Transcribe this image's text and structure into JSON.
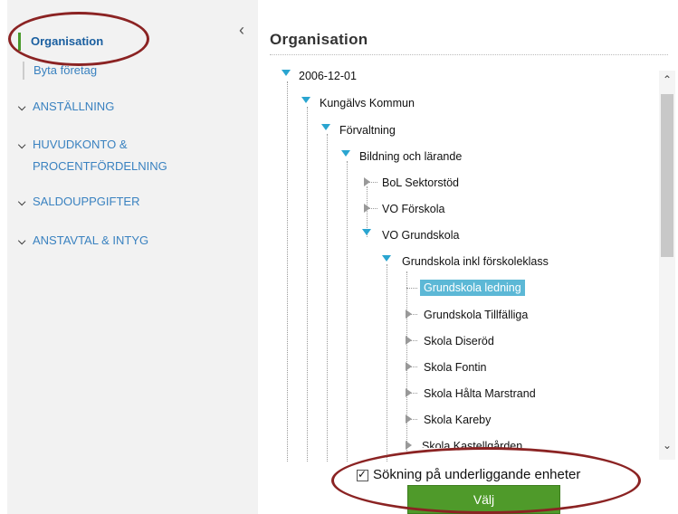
{
  "sidebar": {
    "active_item": "Organisation",
    "sub_item": "Byta företag",
    "collapse_icon": "chevron-left-icon",
    "sections": [
      {
        "label": "ANSTÄLLNING"
      },
      {
        "label_line1": "HUVUDKONTO &",
        "label_line2": "PROCENTFÖRDELNING"
      },
      {
        "label": "SALDOUPPGIFTER"
      },
      {
        "label": "ANSTAVTAL & INTYG"
      }
    ]
  },
  "main": {
    "title": "Organisation"
  },
  "tree": {
    "nodes": [
      {
        "label": "2006-12-01",
        "state": "expanded"
      },
      {
        "label": "Kungälvs Kommun",
        "state": "expanded"
      },
      {
        "label": "Förvaltning",
        "state": "expanded"
      },
      {
        "label": "Bildning och lärande",
        "state": "expanded"
      },
      {
        "label": "BoL Sektorstöd",
        "state": "collapsed"
      },
      {
        "label": "VO Förskola",
        "state": "collapsed"
      },
      {
        "label": "VO Grundskola",
        "state": "expanded"
      },
      {
        "label": "Grundskola inkl förskoleklass",
        "state": "expanded"
      },
      {
        "label": "Grundskola ledning",
        "state": "selected"
      },
      {
        "label": "Grundskola Tillfälliga",
        "state": "collapsed"
      },
      {
        "label": "Skola Diseröd",
        "state": "collapsed"
      },
      {
        "label": "Skola Fontin",
        "state": "collapsed"
      },
      {
        "label": "Skola Hålta Marstrand",
        "state": "collapsed"
      },
      {
        "label": "Skola Kareby",
        "state": "collapsed"
      },
      {
        "label": "Skola Kastellgården",
        "state": "collapsed"
      }
    ]
  },
  "search_option": {
    "label": "Sökning på underliggande enheter",
    "checked": true
  },
  "submit": {
    "label": "Välj"
  },
  "colors": {
    "accent_green": "#4f9a2a",
    "link_blue": "#3a82c0",
    "selection": "#5cb8d6",
    "annotation": "#8b2323"
  }
}
